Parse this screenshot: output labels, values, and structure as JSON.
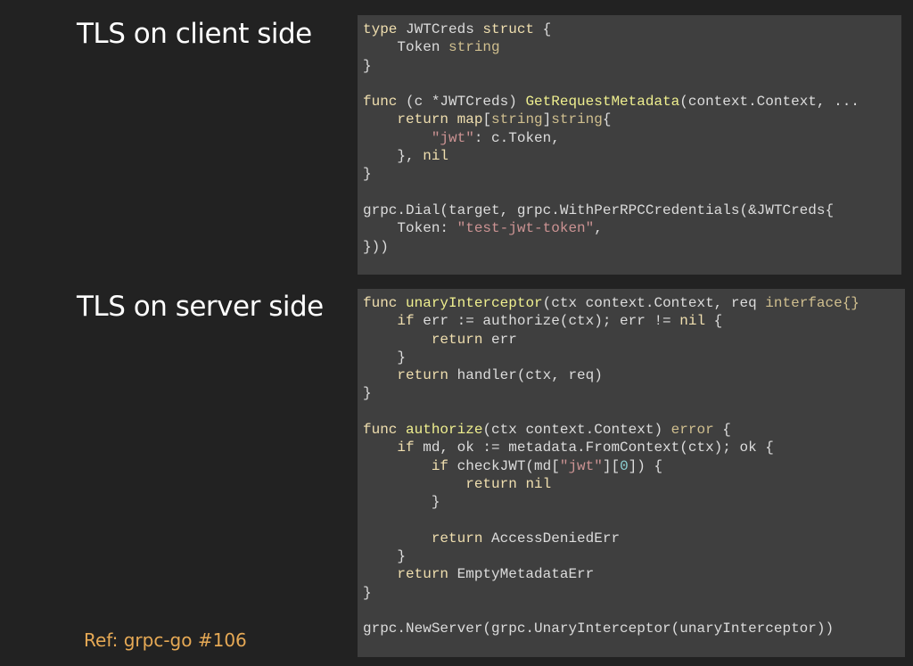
{
  "sections": {
    "client": {
      "title": "TLS on client side",
      "code": [
        [
          [
            "kw",
            "type"
          ],
          [
            "plain",
            " JWTCreds "
          ],
          [
            "kw",
            "struct"
          ],
          [
            "plain",
            " {"
          ]
        ],
        [
          [
            "plain",
            "    Token "
          ],
          [
            "type",
            "string"
          ]
        ],
        [
          [
            "plain",
            "}"
          ]
        ],
        [],
        [
          [
            "kw",
            "func"
          ],
          [
            "plain",
            " (c *JWTCreds) "
          ],
          [
            "fn",
            "GetRequestMetadata"
          ],
          [
            "plain",
            "(context.Context, ..."
          ]
        ],
        [
          [
            "plain",
            "    "
          ],
          [
            "kw",
            "return"
          ],
          [
            "plain",
            " "
          ],
          [
            "kw",
            "map"
          ],
          [
            "plain",
            "["
          ],
          [
            "type",
            "string"
          ],
          [
            "plain",
            "]"
          ],
          [
            "type",
            "string"
          ],
          [
            "plain",
            "{"
          ]
        ],
        [
          [
            "plain",
            "        "
          ],
          [
            "str",
            "\"jwt\""
          ],
          [
            "plain",
            ": c.Token,"
          ]
        ],
        [
          [
            "plain",
            "    }, "
          ],
          [
            "kw",
            "nil"
          ]
        ],
        [
          [
            "plain",
            "}"
          ]
        ],
        [],
        [
          [
            "plain",
            "grpc.Dial(target, grpc.WithPerRPCCredentials(&JWTCreds{"
          ]
        ],
        [
          [
            "plain",
            "    Token: "
          ],
          [
            "str",
            "\"test-jwt-token\""
          ],
          [
            "plain",
            ","
          ]
        ],
        [
          [
            "plain",
            "}))"
          ]
        ]
      ]
    },
    "server": {
      "title": "TLS on server side",
      "code": [
        [
          [
            "kw",
            "func"
          ],
          [
            "plain",
            " "
          ],
          [
            "fn",
            "unaryInterceptor"
          ],
          [
            "plain",
            "(ctx context.Context, req "
          ],
          [
            "type",
            "interface{}"
          ]
        ],
        [
          [
            "plain",
            "    "
          ],
          [
            "kw",
            "if"
          ],
          [
            "plain",
            " err := authorize(ctx); err != "
          ],
          [
            "kw",
            "nil"
          ],
          [
            "plain",
            " {"
          ]
        ],
        [
          [
            "plain",
            "        "
          ],
          [
            "kw",
            "return"
          ],
          [
            "plain",
            " err"
          ]
        ],
        [
          [
            "plain",
            "    }"
          ]
        ],
        [
          [
            "plain",
            "    "
          ],
          [
            "kw",
            "return"
          ],
          [
            "plain",
            " handler(ctx, req)"
          ]
        ],
        [
          [
            "plain",
            "}"
          ]
        ],
        [],
        [
          [
            "kw",
            "func"
          ],
          [
            "plain",
            " "
          ],
          [
            "fn",
            "authorize"
          ],
          [
            "plain",
            "(ctx context.Context) "
          ],
          [
            "type",
            "error"
          ],
          [
            "plain",
            " {"
          ]
        ],
        [
          [
            "plain",
            "    "
          ],
          [
            "kw",
            "if"
          ],
          [
            "plain",
            " md, ok := metadata.FromContext(ctx); ok {"
          ]
        ],
        [
          [
            "plain",
            "        "
          ],
          [
            "kw",
            "if"
          ],
          [
            "plain",
            " checkJWT(md["
          ],
          [
            "str",
            "\"jwt\""
          ],
          [
            "plain",
            "]["
          ],
          [
            "num",
            "0"
          ],
          [
            "plain",
            "]) {"
          ]
        ],
        [
          [
            "plain",
            "            "
          ],
          [
            "kw",
            "return"
          ],
          [
            "plain",
            " "
          ],
          [
            "kw",
            "nil"
          ]
        ],
        [
          [
            "plain",
            "        }"
          ]
        ],
        [],
        [
          [
            "plain",
            "        "
          ],
          [
            "kw",
            "return"
          ],
          [
            "plain",
            " AccessDeniedErr"
          ]
        ],
        [
          [
            "plain",
            "    }"
          ]
        ],
        [
          [
            "plain",
            "    "
          ],
          [
            "kw",
            "return"
          ],
          [
            "plain",
            " EmptyMetadataErr"
          ]
        ],
        [
          [
            "plain",
            "}"
          ]
        ],
        [],
        [
          [
            "plain",
            "grpc.NewServer(grpc.UnaryInterceptor(unaryInterceptor))"
          ]
        ]
      ]
    }
  },
  "ref": "Ref: grpc-go #106",
  "colors": {
    "background": "#222222",
    "code_background": "#3f3f3f",
    "keyword": "#f0dfaf",
    "type": "#d0bf8f",
    "function": "#efef8f",
    "string": "#cc9393",
    "number": "#8cd0d3",
    "plain": "#dcdcdc",
    "ref_text": "#e6a955"
  }
}
